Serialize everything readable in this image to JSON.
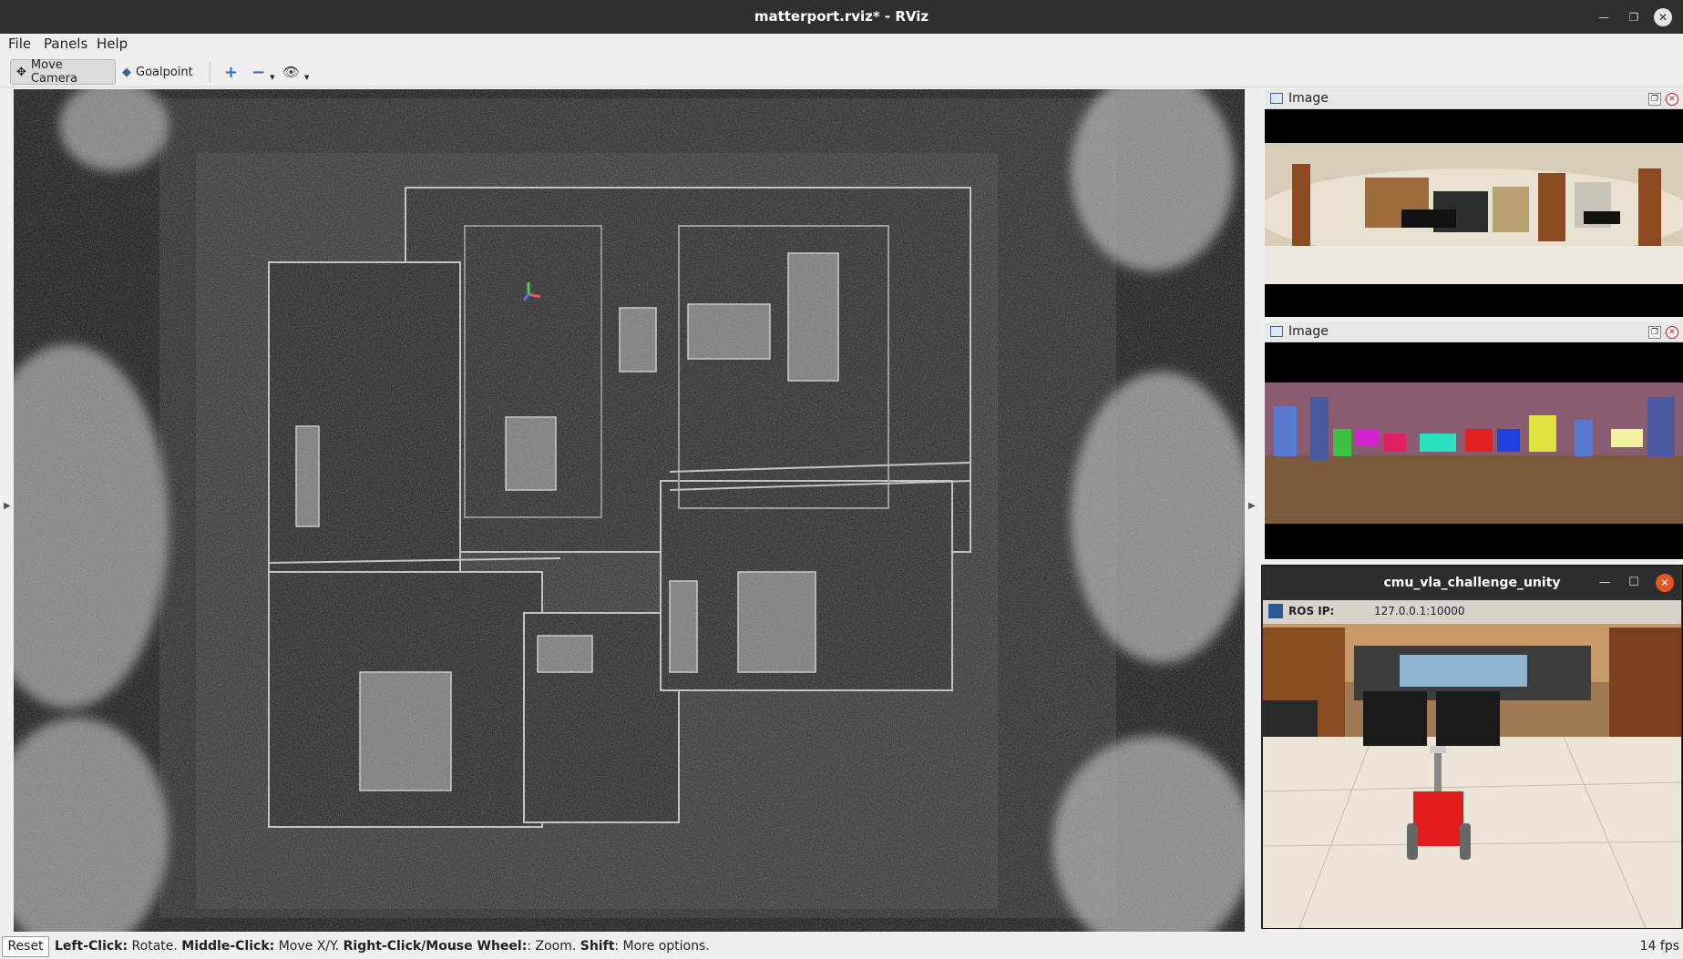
{
  "window": {
    "title": "matterport.rviz* - RViz"
  },
  "menu": [
    "File",
    "Panels",
    "Help"
  ],
  "toolbar": {
    "move_camera": "Move Camera",
    "goalpoint": "Goalpoint"
  },
  "panels": {
    "image1_title": "Image",
    "image2_title": "Image"
  },
  "unity": {
    "title": "cmu_vla_challenge_unity",
    "ros_ip_label": "ROS IP:",
    "ros_ip_value": "127.0.0.1:10000"
  },
  "status": {
    "reset": "Reset",
    "left_click_label": "Left-Click:",
    "left_click_text": " Rotate. ",
    "middle_click_label": "Middle-Click:",
    "middle_click_text": " Move X/Y. ",
    "right_click_label": "Right-Click/Mouse Wheel:",
    "right_click_text": ": Zoom. ",
    "shift_label": "Shift",
    "shift_text": ": More options.",
    "fps": "14 fps"
  },
  "colors": {
    "titlebar": "#2f2f2f",
    "close_orange": "#e95420",
    "robot_red": "#e21c1c"
  }
}
